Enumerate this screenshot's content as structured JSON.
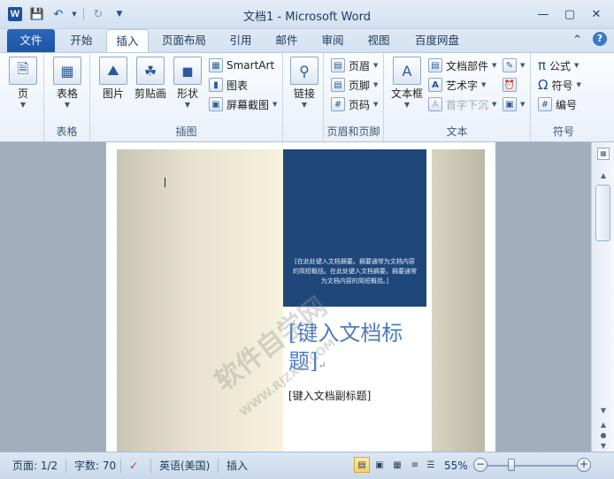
{
  "window": {
    "title": "文档1 - Microsoft Word",
    "app_icon_letter": "W"
  },
  "quick_access": {
    "icons": [
      "save-icon",
      "undo-icon",
      "redo-icon",
      "customize-icon"
    ]
  },
  "tabs": [
    {
      "label": "文件"
    },
    {
      "label": "开始"
    },
    {
      "label": "插入"
    },
    {
      "label": "页面布局"
    },
    {
      "label": "引用"
    },
    {
      "label": "邮件"
    },
    {
      "label": "审阅"
    },
    {
      "label": "视图"
    },
    {
      "label": "百度网盘"
    }
  ],
  "ribbon": {
    "groups": {
      "pages": {
        "label": "",
        "button": "页"
      },
      "tables": {
        "label": "表格",
        "button": "表格"
      },
      "illustrations": {
        "label": "插图",
        "picture": "图片",
        "clipart": "剪贴画",
        "shapes": "形状",
        "smartart": "SmartArt",
        "chart": "图表",
        "screenshot": "屏幕截图"
      },
      "links": {
        "label": "",
        "button": "链接"
      },
      "header_footer": {
        "label": "页眉和页脚",
        "header": "页眉",
        "footer": "页脚",
        "page_number": "页码"
      },
      "text": {
        "label": "文本",
        "textbox": "文本框",
        "quickparts": "文档部件",
        "wordart": "艺术字",
        "dropcap": "首字下沉"
      },
      "symbols": {
        "label": "符号",
        "equation": "公式",
        "symbol": "符号",
        "numbering": "编号"
      }
    }
  },
  "document": {
    "abstract": "[在此处键入文档摘要。摘要通常为文档内容的简短概括。在此处键入文档摘要。摘要通常为文档内容的简短概括。]",
    "title_line1": "[键入文档标",
    "title_line2": "题]",
    "title_mark": "↵",
    "subtitle": "[键入文档副标题]",
    "watermark": "软件自学网",
    "watermark2": "WWW.RJZXW.COM"
  },
  "statusbar": {
    "page": "页面: 1/2",
    "words": "字数: 70",
    "language": "英语(美国)",
    "mode": "插入",
    "zoom": "55%",
    "zoom_level": 0.55
  },
  "colors": {
    "file_tab": "#1d54a4",
    "blue_box": "#1f477a",
    "title_text": "#4b7cc0"
  }
}
